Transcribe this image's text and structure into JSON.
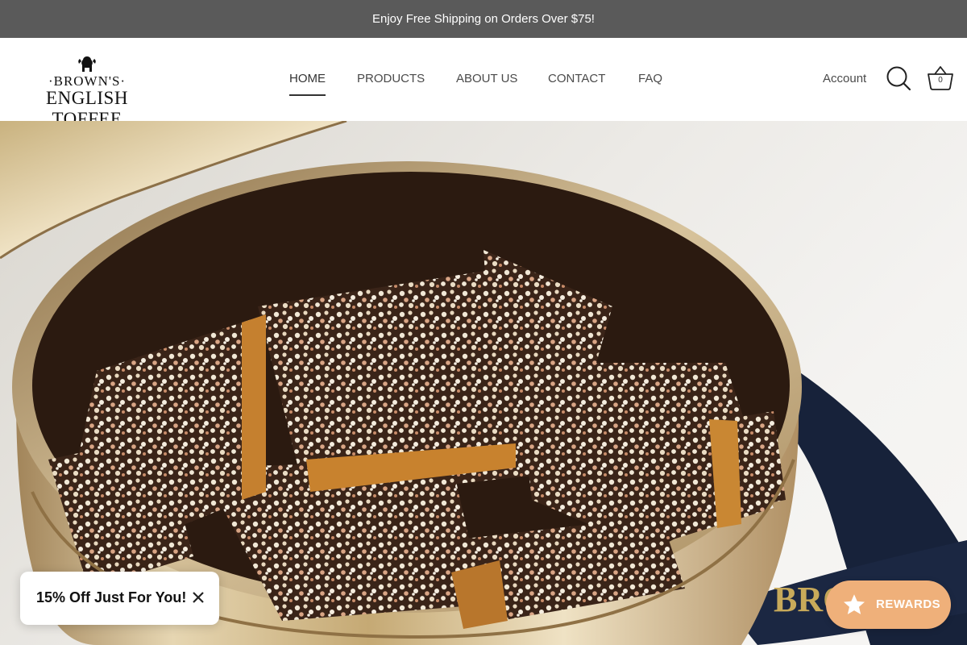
{
  "announcement": "Enjoy Free Shipping on Orders Over $75!",
  "logo": {
    "line1": "·BROWN'S·",
    "line2": "ENGLISH TOFFEE",
    "emblem": "lion-crest-icon"
  },
  "nav": {
    "items": [
      {
        "label": "HOME",
        "active": true
      },
      {
        "label": "PRODUCTS",
        "active": false
      },
      {
        "label": "ABOUT US",
        "active": false
      },
      {
        "label": "CONTACT",
        "active": false
      },
      {
        "label": "FAQ",
        "active": false
      }
    ]
  },
  "header_actions": {
    "account_label": "Account",
    "search_icon": "search-icon",
    "cart_icon": "basket-icon",
    "cart_count": "0"
  },
  "hero": {
    "ribbon_text": "BROWNS",
    "image": "gold tin of almond-topped chocolate toffee pieces"
  },
  "promo_popup": {
    "text": "15% Off Just For You!",
    "close_icon": "close-icon"
  },
  "rewards": {
    "label": "REWARDS",
    "icon": "star-icon",
    "color": "#efb07a"
  },
  "colors": {
    "announcement_bg": "#5a5a5a",
    "nav_text": "#4a4a4a"
  }
}
